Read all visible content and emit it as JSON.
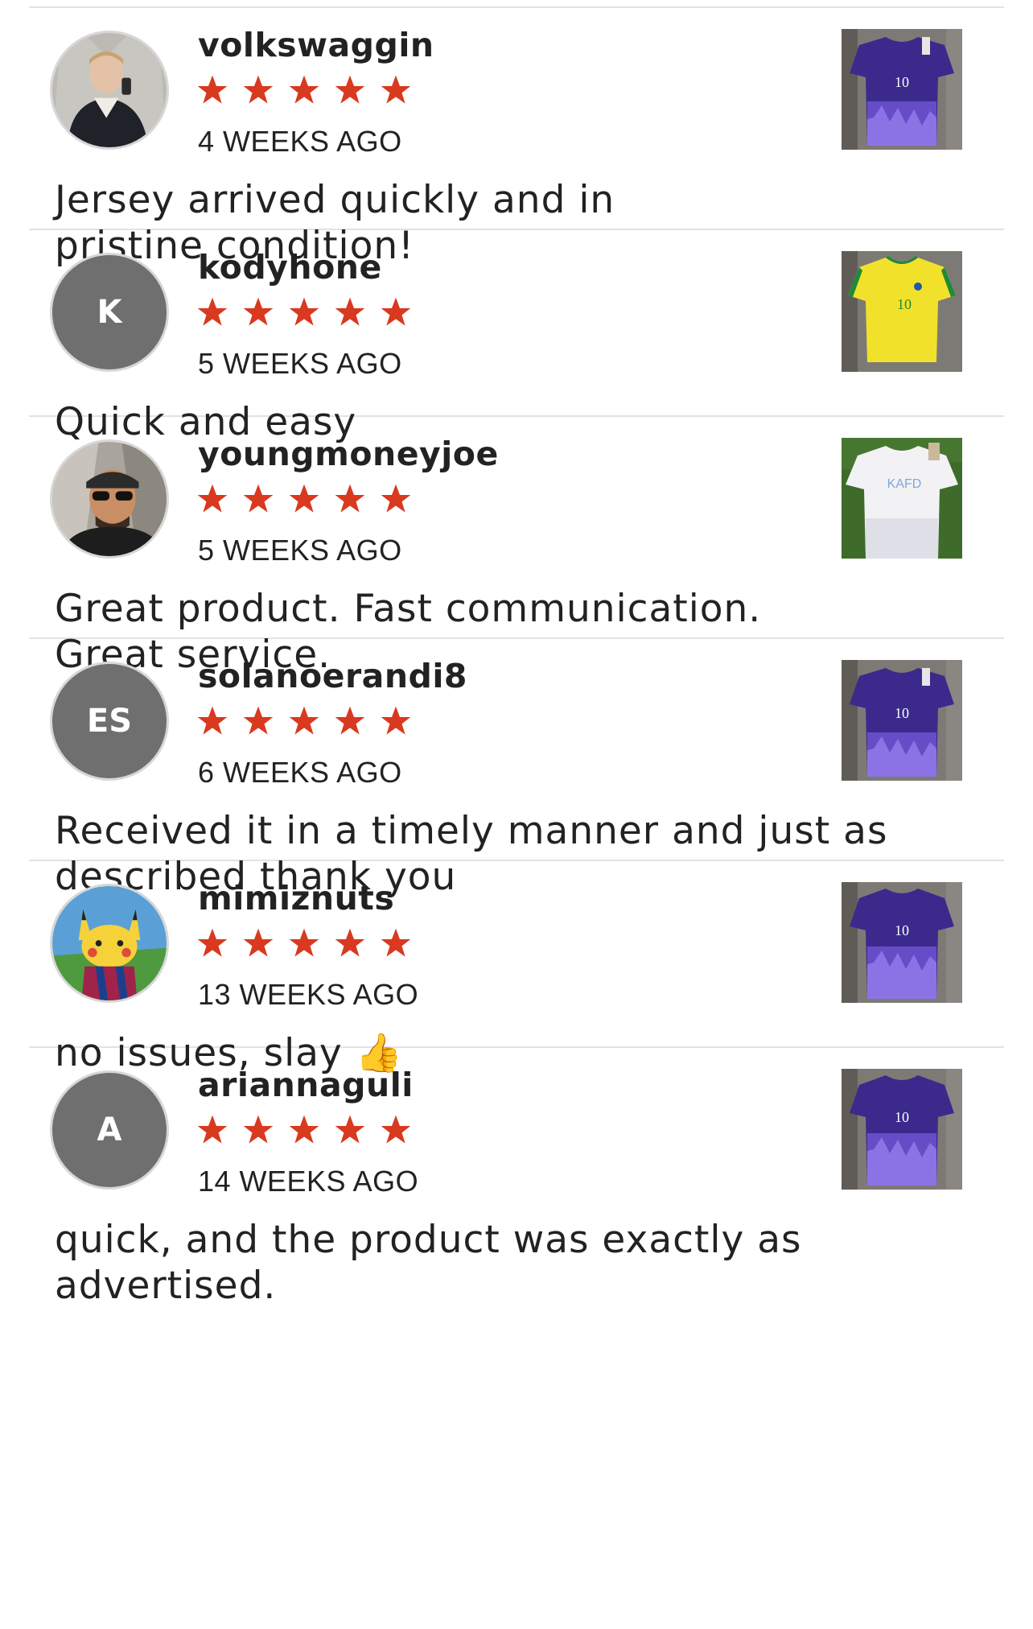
{
  "reviews": [
    {
      "username": "volkswaggin",
      "rating": 5,
      "date": "4 WEEKS AGO",
      "text": "Jersey arrived quickly and in pristine condition!",
      "avatar": {
        "type": "photo",
        "icon": "person-photo"
      },
      "product": {
        "icon": "purple-jersey-thumbnail",
        "jersey_number": "10",
        "color": "#3b2a8c"
      }
    },
    {
      "username": "kodyhone",
      "rating": 5,
      "date": "5 WEEKS AGO",
      "text": "Quick and easy",
      "avatar": {
        "type": "initials",
        "initials": "K"
      },
      "product": {
        "icon": "yellow-jersey-thumbnail",
        "jersey_number": "10",
        "color": "#f2e12a"
      }
    },
    {
      "username": "youngmoneyjoe",
      "rating": 5,
      "date": "5 WEEKS AGO",
      "text": "Great product. Fast communication. Great service.",
      "avatar": {
        "type": "photo",
        "icon": "person-photo"
      },
      "product": {
        "icon": "white-jersey-thumbnail",
        "jersey_number": "KAFD",
        "color": "#f2f2f4"
      }
    },
    {
      "username": "solanoerandi8",
      "rating": 5,
      "date": "6 WEEKS AGO",
      "text": "Received it in a timely manner and just as described thank you",
      "avatar": {
        "type": "initials",
        "initials": "ES"
      },
      "product": {
        "icon": "purple-jersey-thumbnail",
        "jersey_number": "10",
        "color": "#3b2a8c"
      }
    },
    {
      "username": "mimiznuts",
      "rating": 5,
      "date": "13 WEEKS AGO",
      "text": "no issues, slay 👍",
      "avatar": {
        "type": "photo",
        "icon": "cartoon-photo"
      },
      "product": {
        "icon": "purple-jersey-thumbnail",
        "jersey_number": "10",
        "color": "#3b2a8c"
      }
    },
    {
      "username": "ariannaguli",
      "rating": 5,
      "date": "14 WEEKS AGO",
      "text": "quick, and the product was exactly as advertised.",
      "avatar": {
        "type": "initials",
        "initials": "A"
      },
      "product": {
        "icon": "purple-jersey-thumbnail",
        "jersey_number": "10",
        "color": "#3b2a8c"
      }
    }
  ],
  "colors": {
    "star": "#d8391f",
    "divider": "#e2e2e2",
    "avatar_initials_bg": "#6f6f6f",
    "text": "#222222"
  }
}
